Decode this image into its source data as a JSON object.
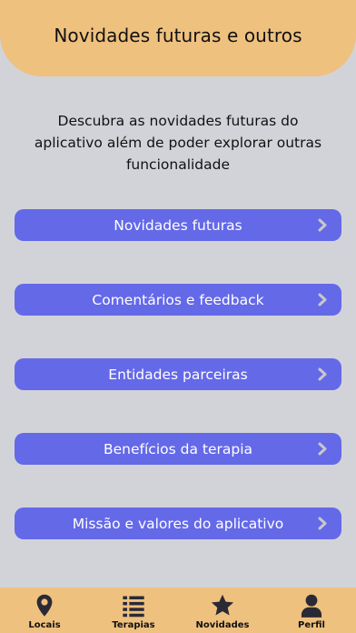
{
  "header": {
    "title": "Novidades futuras e outros"
  },
  "intro": {
    "text": "Descubra as novidades futuras do aplicativo além de poder explorar outras funcionalidade"
  },
  "menu": {
    "items": [
      {
        "label": "Novidades futuras"
      },
      {
        "label": "Comentários e feedback"
      },
      {
        "label": "Entidades parceiras"
      },
      {
        "label": "Benefícios da terapia"
      },
      {
        "label": "Missão e valores do aplicativo"
      }
    ],
    "chevron_icon": "chevron-right-icon"
  },
  "tabbar": {
    "tabs": [
      {
        "label": "Locais",
        "icon": "map-pin-icon"
      },
      {
        "label": "Terapias",
        "icon": "list-icon"
      },
      {
        "label": "Novidades",
        "icon": "star-icon"
      },
      {
        "label": "Perfil",
        "icon": "user-icon"
      }
    ]
  },
  "colors": {
    "accent": "#efc17f",
    "button": "#6469e8",
    "background": "#d2d3d9"
  }
}
